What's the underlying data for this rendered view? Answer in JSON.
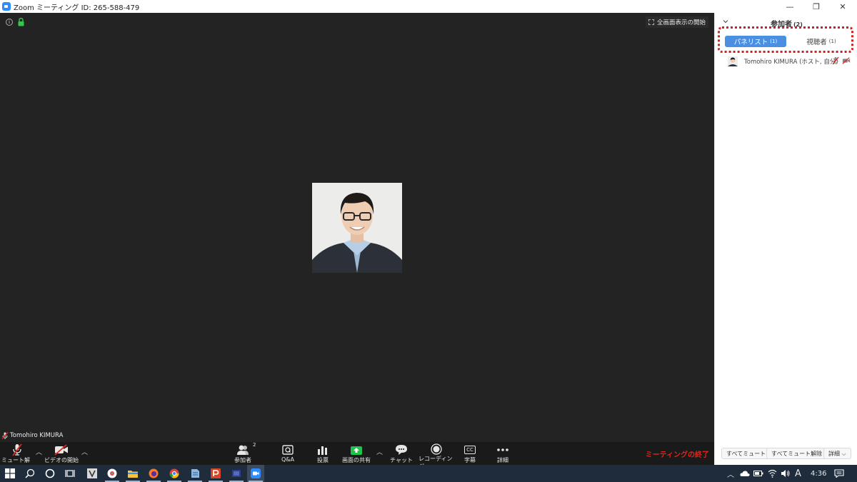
{
  "window": {
    "title": "Zoom ミーティング ID: 265-588-479",
    "minimize": "—",
    "restore": "❐",
    "close": "✕"
  },
  "video": {
    "fullscreen_label": "全画面表示の開始",
    "participant_name": "Tomohiro KIMURA"
  },
  "toolbar": {
    "unmute_label": "ミュート解除",
    "start_video_label": "ビデオの開始",
    "participants_label": "参加者",
    "participants_count": "2",
    "qa_label": "Q&A",
    "poll_label": "投票",
    "share_label": "画面の共有",
    "chat_label": "チャット",
    "record_label": "レコーディング",
    "cc_label": "字幕",
    "cc_glyph": "CC",
    "more_label": "詳細",
    "end_label": "ミーティングの終了",
    "share_color": "#22c24a",
    "end_color": "#e0251d"
  },
  "panel": {
    "title": "参加者",
    "count": "(2)",
    "tabs": [
      {
        "label": "パネリスト",
        "count": "(1)",
        "active": true
      },
      {
        "label": "視聴者",
        "count": "(1)",
        "active": false
      }
    ],
    "participant": {
      "name": "Tomohiro KIMURA (ホスト, 自分)"
    },
    "buttons": {
      "mute_all": "すべてミュート",
      "unmute_all": "すべてミュート解除",
      "more": "詳細 ⌵"
    },
    "accent": "#4a8fe2",
    "highlight": "#e11818"
  },
  "taskbar": {
    "time": "4:36",
    "ime": "A"
  }
}
